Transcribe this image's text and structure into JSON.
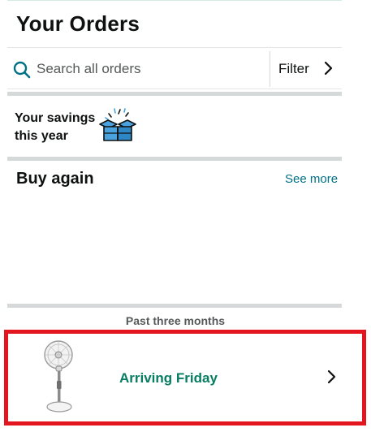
{
  "header": {
    "title": "Your Orders"
  },
  "search": {
    "placeholder": "Search all orders",
    "value": "",
    "filter_label": "Filter"
  },
  "savings": {
    "label": "Your savings this year"
  },
  "buy_again": {
    "title": "Buy again",
    "see_more_label": "See more"
  },
  "orders": {
    "section_label": "Past three months",
    "items": [
      {
        "status": "Arriving Friday",
        "product_icon": "stand-fan-icon"
      }
    ]
  },
  "colors": {
    "accent_teal": "#007185",
    "status_green": "#067d62",
    "highlight_red": "#e3161f",
    "divider_gray": "#d5d9d9",
    "gift_blue": "#4aa3df"
  },
  "icons": {
    "search": "search-icon",
    "filter_chevron": "chevron-right-icon",
    "savings": "gift-box-icon",
    "order_chevron": "chevron-right-icon"
  }
}
